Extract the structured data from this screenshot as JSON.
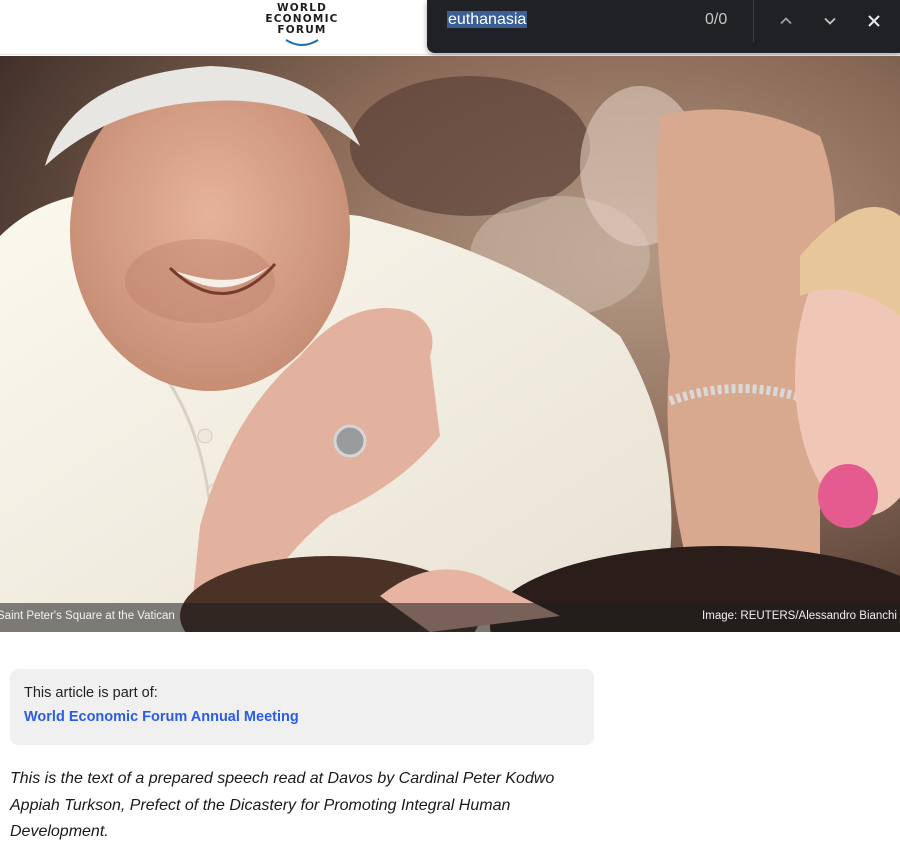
{
  "header": {
    "logo": {
      "line1": "WORLD",
      "line2": "ECONOMIC",
      "line3": "FORUM",
      "icon": "wef-arc-logo"
    }
  },
  "find_bar": {
    "query": "euthanasia",
    "count": "0/0",
    "icons": {
      "previous": "chevron-up-icon",
      "next": "chevron-down-icon",
      "close": "close-icon"
    }
  },
  "hero": {
    "caption_left": "Saint Peter's Square at the Vatican",
    "caption_right": "Image: REUTERS/Alessandro Bianchi"
  },
  "article_part": {
    "label": "This article is part of:",
    "link": "World Economic Forum Annual Meeting"
  },
  "intro": {
    "text": "This is the text of a prepared speech read at Davos by Cardinal Peter Kodwo Appiah Turkson, Prefect of the Dicastery for Promoting Integral Human Development."
  },
  "colors": {
    "find_bar_bg": "#202124",
    "query_highlight": "#3b5f93",
    "link_blue": "#2a5ce6",
    "part_box_bg": "#f0f0f0"
  }
}
